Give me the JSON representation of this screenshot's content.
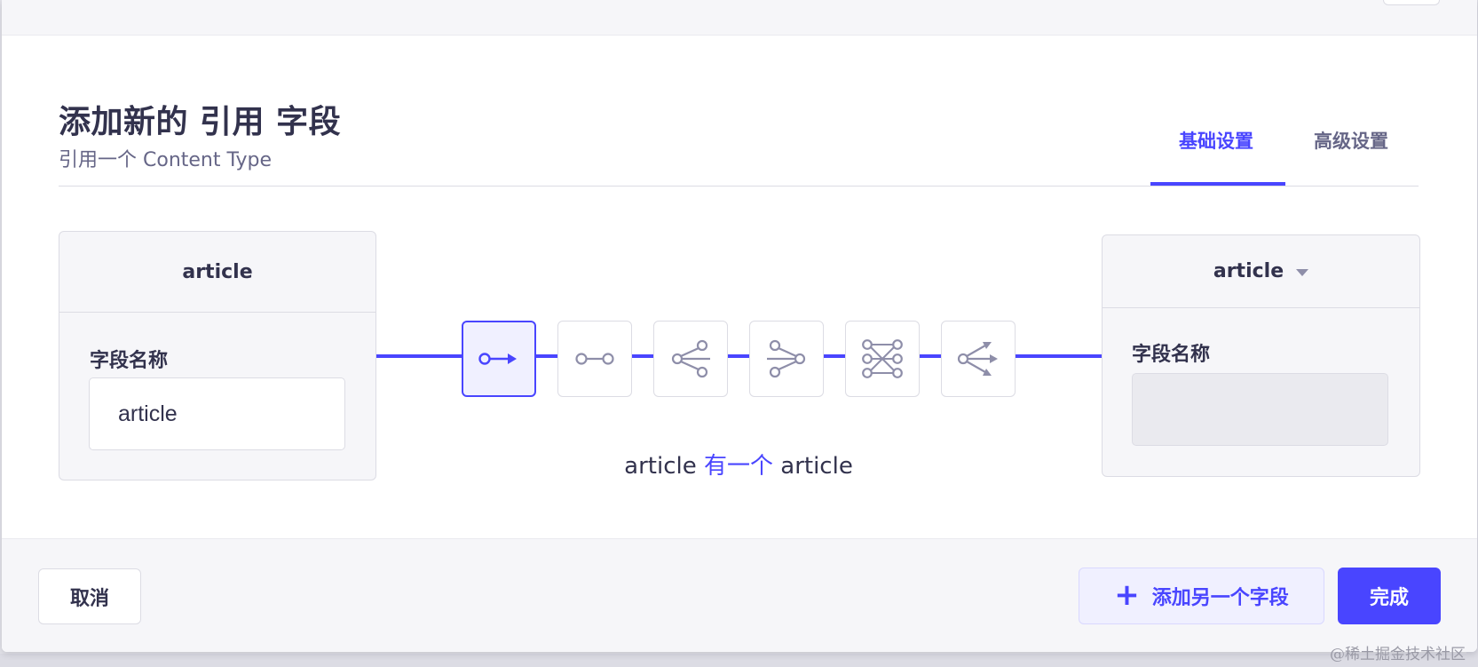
{
  "modal": {
    "title": "添加新的 引用 字段",
    "subtitle": "引用一个 Content Type"
  },
  "tabs": [
    {
      "label": "基础设置",
      "active": true
    },
    {
      "label": "高级设置",
      "active": false
    }
  ],
  "left_card": {
    "header": "article",
    "field_label": "字段名称",
    "field_value": "article"
  },
  "right_card": {
    "header": "article",
    "field_label": "字段名称",
    "field_value": ""
  },
  "relation_types": [
    {
      "icon": "one-way-icon",
      "selected": true
    },
    {
      "icon": "one-to-one-icon",
      "selected": false
    },
    {
      "icon": "one-to-many-icon",
      "selected": false
    },
    {
      "icon": "many-to-one-icon",
      "selected": false
    },
    {
      "icon": "many-to-many-icon",
      "selected": false
    },
    {
      "icon": "many-way-icon",
      "selected": false
    }
  ],
  "relation_caption": {
    "left": "article",
    "relation": "有一个",
    "right": "article"
  },
  "footer": {
    "cancel_label": "取消",
    "add_another_label": "添加另一个字段",
    "finish_label": "完成"
  },
  "watermark": "@稀土掘金技术社区",
  "colors": {
    "primary": "#4945ff",
    "primary_light": "#f0f0ff",
    "text_dark": "#32324d",
    "text_muted": "#666687",
    "icon_gray": "#8e8ea9",
    "border": "#dcdce4",
    "neutral_bg": "#f6f6f9"
  }
}
